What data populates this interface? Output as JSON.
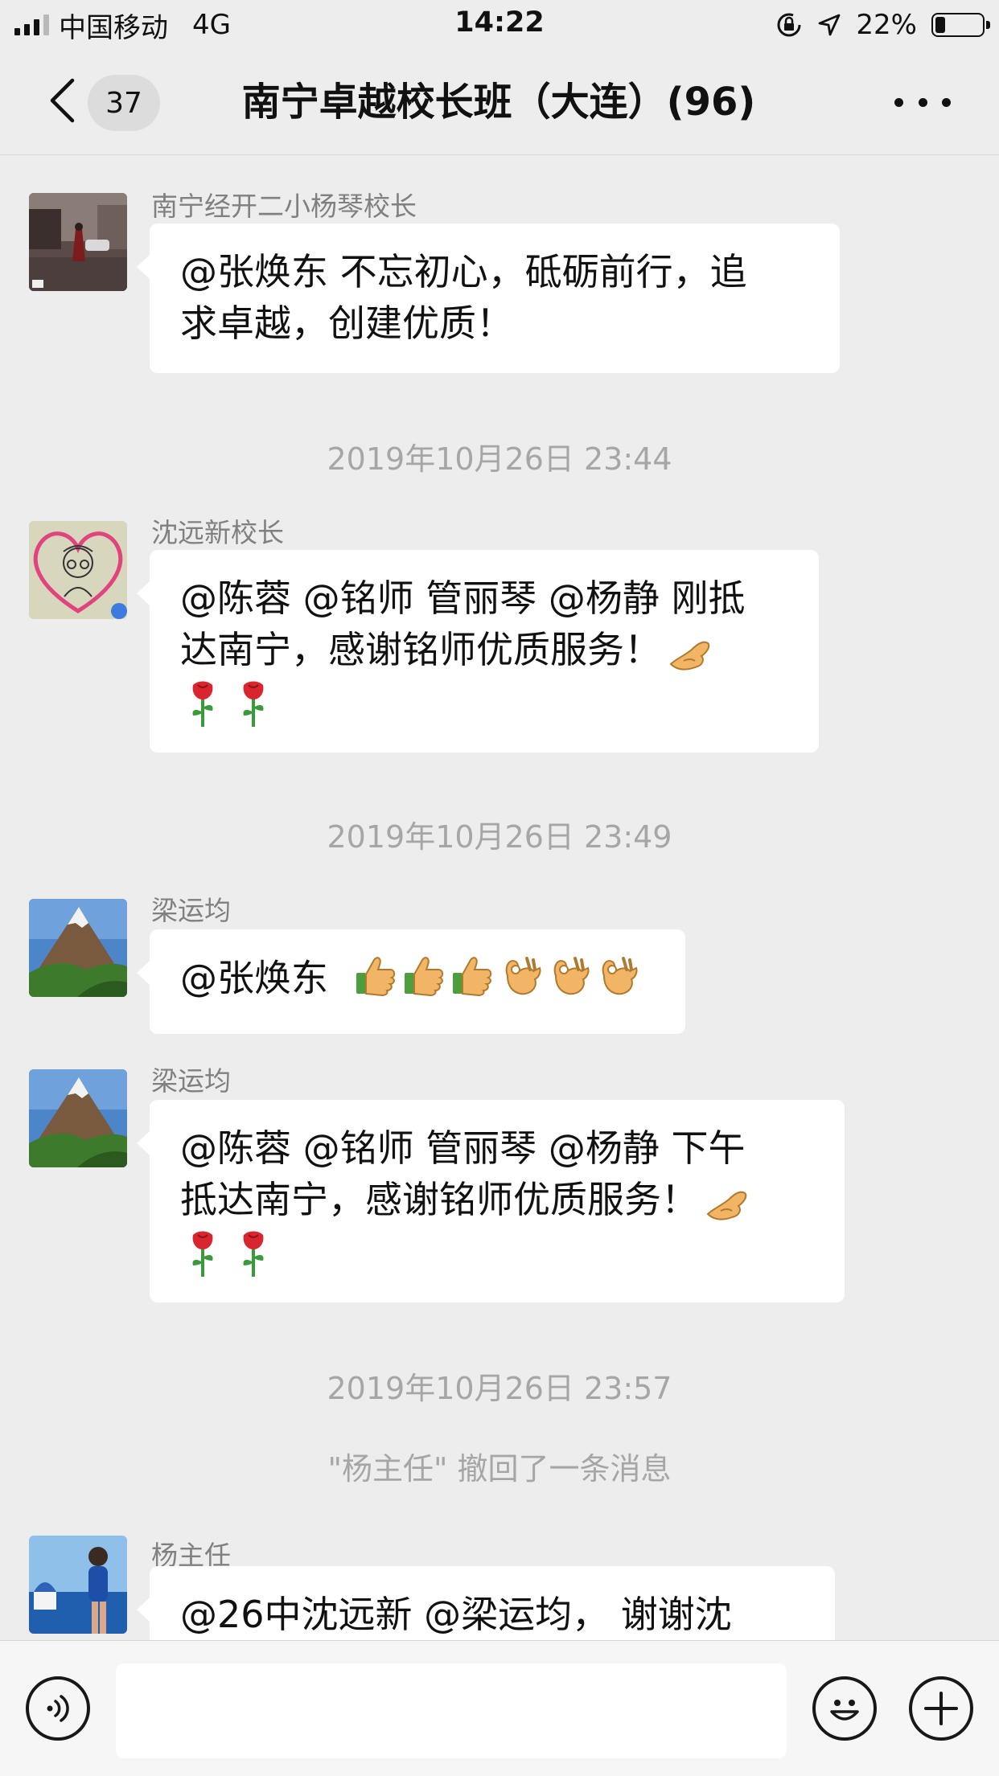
{
  "status_bar": {
    "carrier": "中国移动",
    "network": "4G",
    "time": "14:22",
    "battery": "22%",
    "battery_level": 0.22,
    "icons": [
      "signal-icon",
      "rotation-lock-icon",
      "location-arrow-icon",
      "battery-icon"
    ]
  },
  "nav": {
    "unread_count": "37",
    "title": "南宁卓越校长班（大连）(96)",
    "icons": [
      "back-chevron-icon",
      "more-icon"
    ]
  },
  "messages": [
    {
      "sender": "南宁经开二小杨琴校长",
      "lines": [
        "@张焕东 不忘初心，砥砺前行，追",
        "求卓越，创建优质！"
      ]
    },
    {
      "time_separator": "2019年10月26日 23:44"
    },
    {
      "sender": "沈远新校长",
      "lines": [
        "@陈蓉 @铭师 管丽琴 @杨静 刚抵",
        "达南宁，感谢铭师优质服务！"
      ],
      "emoji": [
        "ok-hand-emoji",
        "rose-emoji",
        "rose-emoji"
      ]
    },
    {
      "time_separator": "2019年10月26日 23:49"
    },
    {
      "sender": "梁运均",
      "lines": [
        "@张焕东"
      ],
      "emoji": [
        "thumbs-up-emoji",
        "thumbs-up-emoji",
        "thumbs-up-emoji",
        "ok-sign-emoji",
        "ok-sign-emoji",
        "ok-sign-emoji"
      ]
    },
    {
      "sender": "梁运均",
      "lines": [
        "@陈蓉 @铭师 管丽琴 @杨静 下午",
        "抵达南宁，感谢铭师优质服务！"
      ],
      "emoji": [
        "ok-hand-emoji",
        "rose-emoji",
        "rose-emoji"
      ]
    },
    {
      "time_separator": "2019年10月26日 23:57"
    },
    {
      "system": "\"杨主任\" 撤回了一条消息"
    },
    {
      "sender": "杨主任",
      "lines": [
        "@26中沈远新 @梁运均， 谢谢沈"
      ]
    }
  ],
  "input_bar": {
    "placeholder": "",
    "icons": [
      "voice-icon",
      "emoji-face-icon",
      "plus-icon"
    ]
  },
  "colors": {
    "background": "#ededed",
    "bubble": "#ffffff",
    "secondary_text": "#808080",
    "timestamp_text": "#a6a6a6"
  }
}
